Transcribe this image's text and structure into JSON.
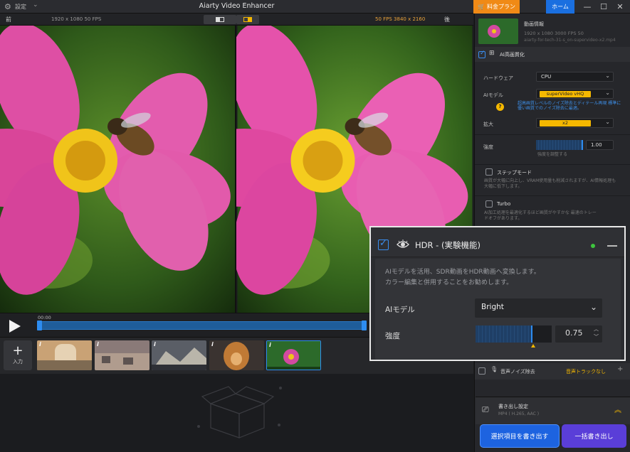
{
  "titlebar": {
    "settings_label": "設定",
    "app_title": "Aiarty Video Enhancer",
    "plan_label": "料金プラン",
    "home_label": "ホーム"
  },
  "preview": {
    "before_label": "前",
    "after_label": "後",
    "left_resolution": "1920 x 1080  50 FPS",
    "right_resolution": "50 FPS  3840 x 2160"
  },
  "playback": {
    "timecode": "00:00"
  },
  "media_strip": {
    "add_label": "入力",
    "thumbs": [
      {
        "badge": "i",
        "colors": [
          "#c9a275",
          "#e6d2b4",
          "#7e6a52"
        ]
      },
      {
        "badge": "i",
        "colors": [
          "#8a7a78",
          "#b09c8e",
          "#5d5351"
        ]
      },
      {
        "badge": "i",
        "colors": [
          "#5a5e66",
          "#b9b5aa",
          "#2e3036"
        ]
      },
      {
        "badge": "i",
        "colors": [
          "#c07a35",
          "#3a3330",
          "#e6b070"
        ]
      },
      {
        "badge": "i",
        "colors": [
          "#2c6a2a",
          "#d24aa0",
          "#183d18"
        ]
      }
    ]
  },
  "panel": {
    "source_name": "動画情報",
    "source_info": "1920 x 1080  3000  FPS 50",
    "source_file": "aiarty-for-tech-31-s_on-supervideo-x2.mp4",
    "ai_section_title": "AI高画質化",
    "hardware_label": "ハードウェア",
    "hardware_value": "CPU",
    "ai_model_label": "AIモデル",
    "ai_model_value": "superVideo vHQ",
    "ai_model_hint": "超高画質レベルのノイズ除去とディテール再現 標準に優い画質でのノイズ除去に最適。",
    "upscale_label": "拡大",
    "upscale_value": "x2",
    "strength_label": "強度",
    "strength_value": "1.00",
    "strength_hint": "強度を調整する",
    "step_mode_label": "ステップモード",
    "step_mode_desc": "画質が大幅に向上し、VRAM使用量も削減されますが、AI情報処理も大幅に低下します。",
    "turbo_label": "Turbo",
    "turbo_desc": "AI加工処理を最適化するほど画質がやすかな 最速のトレードオフがあります。",
    "noise_label": "音声ノイズ除去",
    "noise_value": "音声トラックなし",
    "export_title": "書き出し設定",
    "export_info": "MP4 ( H.265, AAC )",
    "export_selected": "選択項目を書き出す",
    "export_all": "一括書き出し"
  },
  "hdr": {
    "title": "HDR - (実験機能)",
    "desc_line1": "AIモデルを活用、SDR動画をHDR動画へ変換します。",
    "desc_line2": "カラー編集と併用することをお勧めします。",
    "model_label": "AIモデル",
    "model_value": "Bright",
    "strength_label": "強度",
    "strength_value": "0.75",
    "strength_fraction": 0.75,
    "status_color": "#3ec53e"
  }
}
